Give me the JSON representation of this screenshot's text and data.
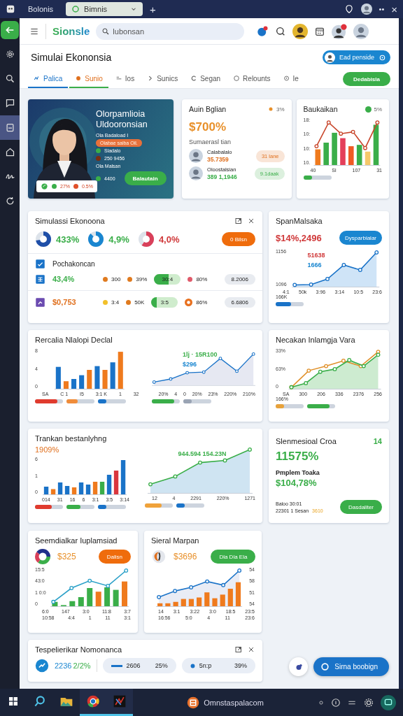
{
  "browser": {
    "tabs": [
      {
        "label": "Bolonis",
        "selected": false
      },
      {
        "label": "Bimnis",
        "selected": true
      }
    ],
    "new_tab": "+",
    "more": "••",
    "close": "×"
  },
  "sidebar": {
    "items": [
      {
        "selected": false
      },
      {
        "selected": false
      },
      {
        "selected": false
      },
      {
        "selected": true
      },
      {
        "selected": false
      },
      {
        "selected": false
      },
      {
        "selected": false
      }
    ]
  },
  "header": {
    "logo": "Sionsle",
    "search": {
      "placeholder": "lubonsan"
    }
  },
  "page": {
    "title": "Simulai Ekononsia",
    "profile_button": "Ead penside",
    "action_button": "Dedabisla",
    "tabs": [
      {
        "label": "Palica",
        "selected": true,
        "highlighted": false
      },
      {
        "label": "Sunio",
        "selected": false,
        "highlighted": true
      },
      {
        "label": "Ios",
        "selected": false,
        "highlighted": false
      },
      {
        "label": "Sunics",
        "selected": false,
        "highlighted": false
      },
      {
        "label": "Segan",
        "selected": false,
        "highlighted": false
      },
      {
        "label": "Relounts",
        "selected": false,
        "highlighted": false
      },
      {
        "label": "Ie",
        "selected": false,
        "highlighted": false
      }
    ]
  },
  "hero": {
    "title": "Olorpamlioia Uldooronsian",
    "subtitle": "Ola Badaload I",
    "tag": "Olabae saiba Oil.",
    "caption": "Ola Malsan",
    "button": "Balautain",
    "stats": [
      {
        "text": "Sladalo",
        "color": "#3aae49"
      },
      {
        "text": "250 9456",
        "color": "#7a2e12"
      }
    ],
    "metric": {
      "text": "4400",
      "color": "#3aae49"
    },
    "chip": [
      {
        "text": "27%",
        "color": "#3aae49"
      },
      {
        "text": "0.5%",
        "color": "#e0502a"
      }
    ]
  },
  "summary": {
    "title": "Auin Bglian",
    "badge": "3%",
    "value": "$700%",
    "caption": "Sumaerasl tian",
    "people": [
      {
        "name": "Calabalalo",
        "value": "35.7359",
        "color": "#e0701e",
        "chip": "31 lane"
      },
      {
        "name": "Oloostalsian",
        "value": "389 1,1946",
        "color": "#3aae49",
        "chip": "9.1daak"
      }
    ]
  },
  "trend": {
    "title": "Baukaikan",
    "badge": "5%",
    "chart": {
      "kind": "bar-line",
      "y_labels": [
        "18:",
        "10:",
        "10:",
        "10."
      ],
      "x_labels": [
        "40",
        "Sl",
        "107",
        "31"
      ],
      "sliders": [
        {
          "level": 0.3,
          "color": "#3aae49"
        }
      ]
    }
  },
  "simulation": {
    "title": "Simulassi Ekonoona",
    "button": "0 Bilsn",
    "section": "Pochakoncan",
    "donuts": [
      {
        "value": {
          "text": "433%",
          "color": "#3aae49"
        },
        "color": "#1f4fa8"
      },
      {
        "value": {
          "text": "4,9%",
          "color": "#3aae49"
        },
        "color": "#1a86d0"
      },
      {
        "value": {
          "text": "4,0%",
          "color": "#d0393a"
        },
        "color": "#d9405a"
      }
    ],
    "rows": [
      {
        "value": "43,4%",
        "color": "#3aae49",
        "items": [
          {
            "kind": "dot",
            "text": "300",
            "color": "#e07a1e"
          },
          {
            "kind": "dot",
            "text": "39%",
            "color": "#e07a1e"
          },
          {
            "kind": "pill",
            "text": "30:4",
            "level": 0.55
          },
          {
            "kind": "dot",
            "text": "80%",
            "color": "#e05a6a"
          },
          {
            "kind": "chip",
            "text": "8.2006"
          }
        ]
      },
      {
        "value": "$0,753",
        "color": "#e0701e",
        "items": [
          {
            "kind": "dot",
            "text": "3:4",
            "color": "#f2c02a"
          },
          {
            "kind": "dot",
            "text": "50K",
            "color": "#e07a1e"
          },
          {
            "kind": "pill",
            "text": "3:5",
            "level": 0.2
          },
          {
            "kind": "ring",
            "text": "86%",
            "color": "#e8701e"
          },
          {
            "kind": "chip",
            "text": "6.6806"
          }
        ]
      }
    ]
  },
  "market": {
    "title": "SpanMalsaka",
    "value": "$14%,2496",
    "button": "Dysparbialar",
    "chart": {
      "kind": "area-line",
      "labels": [
        {
          "text": "51638",
          "color": "#d0393a"
        },
        {
          "text": "1666",
          "color": "#1a86d0"
        }
      ],
      "y_labels": [
        "1156",
        "1096"
      ],
      "x_labels": [
        "4:1",
        "50k",
        "3:96",
        "3:14",
        "10:5",
        "23:6"
      ],
      "footnote": "166K",
      "sliders": [
        {
          "level": 0.55,
          "color": "#1a73c8"
        }
      ]
    }
  },
  "forecast": {
    "title": "Rercalia Nlalopi Declal",
    "charts": [
      {
        "kind": "bars",
        "y_labels": [
          "8",
          "4",
          "0"
        ],
        "x_labels": [
          "SA",
          "C 1",
          "I5",
          "3:1 K",
          "1",
          "32"
        ],
        "sliders": [
          {
            "level": 0.8,
            "color": "#e03b2e"
          },
          {
            "level": 0.4,
            "color": "#f08c3a"
          },
          {
            "level": 0.3,
            "color": "#1a73c8"
          }
        ]
      },
      {
        "kind": "line-area",
        "labels": [
          {
            "text": "1lj · 15R100",
            "color": "#3aae49"
          },
          {
            "text": "$296",
            "color": "#1a86d0"
          }
        ],
        "x_labels": [
          "20%",
          "4",
          "0",
          "20%",
          "23%",
          "220%",
          "210%"
        ],
        "sliders": [
          {
            "level": 0.8,
            "color": "#3aae49"
          },
          {
            "level": 0.3,
            "color": "#9aa4b4"
          }
        ]
      }
    ]
  },
  "inflation": {
    "title": "Necakan Inlamgja Vara",
    "chart": {
      "kind": "two-lines",
      "y_labels": [
        "33%",
        "63%",
        "0"
      ],
      "x_labels": [
        "SA",
        "300",
        "206",
        "336",
        "2376",
        "256"
      ],
      "footnote": "166%",
      "sliders": [
        {
          "level": 0.3,
          "color": "#e8a23a"
        },
        {
          "level": 0.8,
          "color": "#3aae49"
        }
      ]
    }
  },
  "growth": {
    "title": "Trankan bestanlyhng",
    "value": "1909%",
    "charts": [
      {
        "kind": "bars-2",
        "y_labels": [
          "6",
          "1",
          "0"
        ],
        "x_labels": [
          "014",
          "31",
          "16",
          "6",
          "3:1",
          "3:5",
          "3:14"
        ],
        "sliders": [
          {
            "level": 0.6,
            "color": "#e03b2e"
          },
          {
            "level": 0.5,
            "color": "#3aae49"
          },
          {
            "level": 0.3,
            "color": "#1a73c8"
          }
        ]
      },
      {
        "kind": "green-line",
        "labels": [
          {
            "text": "944.594 154.23N",
            "color": "#3aae49"
          }
        ],
        "x_labels": [
          "12",
          "4",
          "2291",
          "220%",
          "1271"
        ],
        "sliders": [
          {
            "level": 0.6,
            "color": "#f0a23a"
          },
          {
            "level": 0.3,
            "color": "#1a73c8"
          }
        ]
      }
    ]
  },
  "crop": {
    "title": "Slenmesioal Croa",
    "badge": "14",
    "value": "11575%",
    "label": "Pmplem Toaka",
    "amount": "$104,78%",
    "note": "Baloo 30:01",
    "detail": "22301 1 Sesan",
    "detail_value": "3610",
    "button": "Dasdaliter"
  },
  "investment": {
    "title": "Seemdialkar Iuplamsiad",
    "value": "$325",
    "button": {
      "label": "Dalisn",
      "color": "#ef6c0c"
    },
    "chart": {
      "kind": "mixed-bars-line",
      "y_labels": [
        "15:5",
        "43:0",
        "1 0:0",
        "0"
      ],
      "x_labels": [
        "6:0",
        "147",
        "3:0",
        "11:8",
        "3:7"
      ],
      "x_labels_2": [
        "10:58",
        "4:4",
        "1",
        "11",
        "3:1"
      ]
    }
  },
  "spending": {
    "title": "Sieral Marpan",
    "value": "$3696",
    "button": {
      "label": "Dla Dla Ela",
      "color": "#3aae49"
    },
    "chart": {
      "kind": "orange-bars-line",
      "y_axis_right": true,
      "y_labels": [
        "54",
        "58",
        "51",
        "54"
      ],
      "x_labels": [
        "14",
        "3:1",
        "3:22",
        "3:0",
        "18:5",
        "23:5"
      ],
      "x_labels_2": [
        "16:56",
        "5:0",
        "4",
        "11",
        "23:6"
      ]
    }
  },
  "performance": {
    "title": "Tespelierikar Nomonanca",
    "value": "2236",
    "change": "2/2%",
    "chips": [
      {
        "text": "2606",
        "share": "25%"
      },
      {
        "text": "5n:p",
        "share": "39%"
      }
    ]
  },
  "assistant_button": "Sirna boobign",
  "taskbar": {
    "app_title": "Omnstaspalacom",
    "apps": [
      {
        "active": false
      },
      {
        "active": false
      },
      {
        "active": true
      },
      {
        "active": true
      }
    ]
  }
}
